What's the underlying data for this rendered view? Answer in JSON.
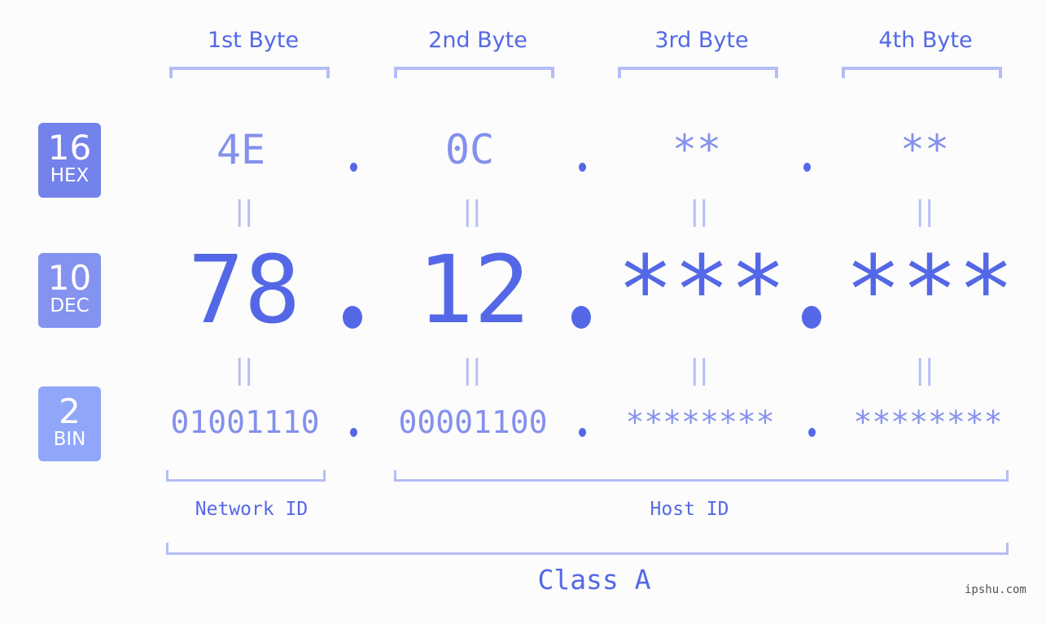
{
  "bytes": {
    "headers": [
      "1st Byte",
      "2nd Byte",
      "3rd Byte",
      "4th Byte"
    ]
  },
  "badges": [
    {
      "num": "16",
      "label": "HEX",
      "color": "#7482eb"
    },
    {
      "num": "10",
      "label": "DEC",
      "color": "#8492f0"
    },
    {
      "num": "2",
      "label": "BIN",
      "color": "#8fa6f9"
    }
  ],
  "hex": [
    "4E",
    "0C",
    "**",
    "**"
  ],
  "dec": [
    "78",
    "12",
    "***",
    "***"
  ],
  "bin": [
    "01001110",
    "00001100",
    "********",
    "********"
  ],
  "equals_glyph": "||",
  "network_label": "Network ID",
  "host_label": "Host ID",
  "class_label": "Class A",
  "watermark": "ipshu.com",
  "colors": {
    "accent": "#5468e7",
    "light_accent": "#8490ed",
    "bracket": "#b4bdf8",
    "background": "#fbfcfb"
  }
}
